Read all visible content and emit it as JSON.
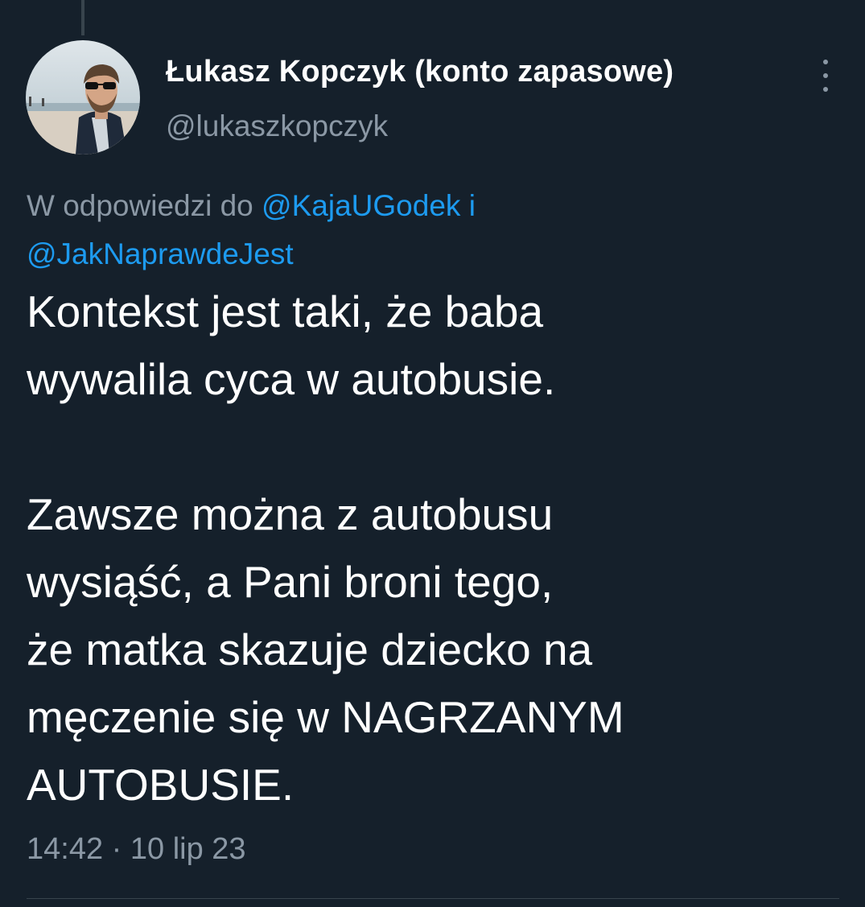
{
  "author": {
    "display_name": "Łukasz Kopczyk (konto zapasowe)",
    "handle": "@lukaszkopczyk",
    "avatar_icon": "profile-photo"
  },
  "more_icon": "more-vertical-icon",
  "reply_context": {
    "prefix": "W odpowiedzi do",
    "mention_1": "@KajaUGodek",
    "conjunction": "i",
    "mention_2": "@JakNaprawdeJest"
  },
  "tweet": {
    "lines": [
      "Kontekst jest taki, że baba",
      "wywalila cyca w autobusie.",
      "",
      "Zawsze można z autobusu",
      "wysiąść, a Pani broni tego,",
      "że matka skazuje dziecko na",
      "męczenie się w NAGRZANYM",
      "AUTOBUSIE."
    ]
  },
  "timestamp": {
    "time": "14:42",
    "separator": "·",
    "date": "10 lip 23"
  },
  "colors": {
    "background": "#15202b",
    "text": "#ffffff",
    "secondary": "#8b98a5",
    "link": "#1d9bf0",
    "divider": "#38444d"
  }
}
